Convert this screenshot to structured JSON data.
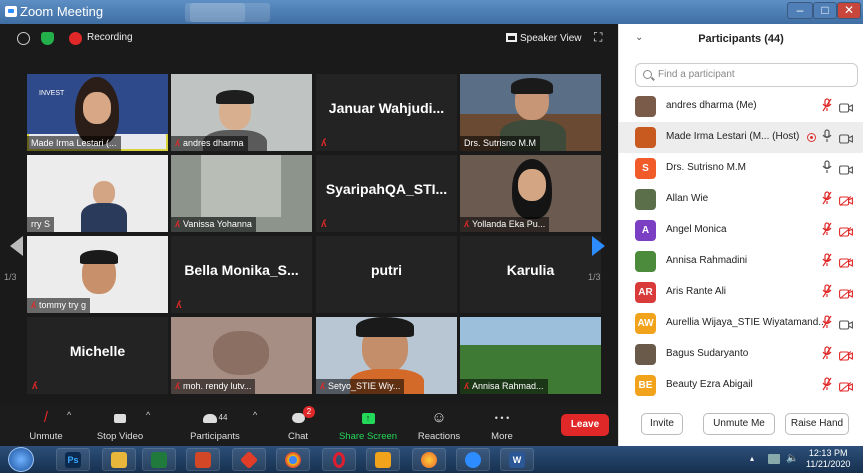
{
  "window": {
    "title": "Zoom Meeting",
    "minimize": "–",
    "maximize": "□",
    "close": "✕"
  },
  "topbar": {
    "recording_label": "Recording",
    "speaker_view": "Speaker View"
  },
  "gallery": {
    "page_left": "1/3",
    "page_right": "1/3"
  },
  "tiles": {
    "t1": "Made Irma Lestari (...",
    "t1_slide": "INVEST",
    "t2": "andres dharma",
    "t3": "Januar Wahjudi...",
    "t4": "Drs. Sutrisno M.M",
    "t5": "rry S",
    "t6": "Vanissa Yohanna",
    "t7": "SyaripahQA_STI...",
    "t8": "Yollanda Eka Pu...",
    "t9": "tommy try g",
    "t10": "Bella Monika_S...",
    "t11": "putri",
    "t12": "Karulia",
    "t13": "Michelle",
    "t14": "moh. rendy lutv...",
    "t15": "Setyo_STIE Wiy...",
    "t16": "Annisa Rahmad..."
  },
  "toolbar": {
    "unmute": "Unmute",
    "stop_video": "Stop Video",
    "participants": "Participants",
    "participants_count": "44",
    "chat": "Chat",
    "chat_badge": "2",
    "share_screen": "Share Screen",
    "reactions": "Reactions",
    "more": "More",
    "more_icon": "• • •",
    "leave": "Leave"
  },
  "panel": {
    "title": "Participants (44)",
    "search_placeholder": "Find a participant",
    "participants": [
      {
        "name": "andres dharma (Me)",
        "initials": "",
        "color": "#7a5a48"
      },
      {
        "name": "Made Irma Lestari (M...  (Host)",
        "initials": "",
        "color": "#c85a20"
      },
      {
        "name": "Drs. Sutrisno M.M",
        "initials": "S",
        "color": "#f15a29"
      },
      {
        "name": "Allan Wie",
        "initials": "",
        "color": "#5b6f4a"
      },
      {
        "name": "Angel Monica",
        "initials": "A",
        "color": "#7b3fc4"
      },
      {
        "name": "Annisa Rahmadini",
        "initials": "",
        "color": "#4c8a3c"
      },
      {
        "name": "Aris Rante Ali",
        "initials": "AR",
        "color": "#d93b3b"
      },
      {
        "name": "Aurellia Wijaya_STIE Wiyatamand...",
        "initials": "AW",
        "color": "#f2a31c"
      },
      {
        "name": "Bagus Sudaryanto",
        "initials": "",
        "color": "#6a5a4a"
      },
      {
        "name": "Beauty Ezra Abigail",
        "initials": "BE",
        "color": "#f2a31c"
      }
    ],
    "invite": "Invite",
    "unmute_me": "Unmute Me",
    "raise_hand": "Raise Hand"
  },
  "taskbar": {
    "apps": [
      "Ps",
      "W"
    ],
    "time": "12:13 PM",
    "date": "11/21/2020"
  },
  "colors": {
    "accent": "#2d8cff",
    "leave": "#e02828",
    "share": "#23d959",
    "active_speaker": "#d8d33a"
  }
}
